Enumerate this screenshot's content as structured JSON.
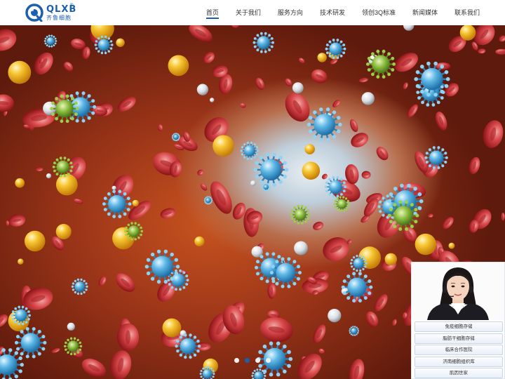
{
  "brand": {
    "logo_en": "QLXB",
    "logo_cn": "齐鲁细胞",
    "registered": "®"
  },
  "nav": {
    "items": [
      {
        "label": "首页",
        "active": true
      },
      {
        "label": "关于我们",
        "active": false
      },
      {
        "label": "服务方向",
        "active": false
      },
      {
        "label": "技术研发",
        "active": false
      },
      {
        "label": "领创3Q标准",
        "active": false
      },
      {
        "label": "新闻媒体",
        "active": false
      },
      {
        "label": "联系我们",
        "active": false
      }
    ]
  },
  "banner": {
    "slide_count": 4,
    "active_slide": 2
  },
  "service_panel": {
    "buttons": [
      "免疫细胞存储",
      "脂肪干细胞存储",
      "临床合作医院",
      "济南细胞组织库",
      "肌因世家"
    ]
  },
  "colors": {
    "brand_blue": "#1c5fae",
    "nav_text": "#333333",
    "cell_red": "#c0272d",
    "cell_yellow": "#f4b41a",
    "cell_blue": "#4aa3d8"
  }
}
